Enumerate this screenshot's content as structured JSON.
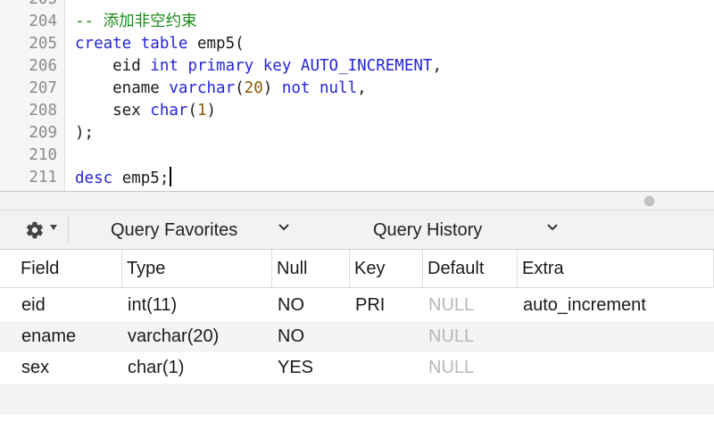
{
  "editor": {
    "lines": [
      {
        "num": "203",
        "tokens": []
      },
      {
        "num": "204",
        "tokens": [
          {
            "t": "-- 添加非空约束",
            "c": "cm"
          }
        ]
      },
      {
        "num": "205",
        "tokens": [
          {
            "t": "create",
            "c": "kw"
          },
          {
            "t": " ",
            "c": ""
          },
          {
            "t": "table",
            "c": "kw"
          },
          {
            "t": " emp5(",
            "c": ""
          }
        ]
      },
      {
        "num": "206",
        "tokens": [
          {
            "t": "    eid ",
            "c": ""
          },
          {
            "t": "int",
            "c": "kw"
          },
          {
            "t": " ",
            "c": ""
          },
          {
            "t": "primary",
            "c": "kw"
          },
          {
            "t": " ",
            "c": ""
          },
          {
            "t": "key",
            "c": "kw"
          },
          {
            "t": " ",
            "c": ""
          },
          {
            "t": "AUTO_INCREMENT",
            "c": "kw"
          },
          {
            "t": ",",
            "c": ""
          }
        ]
      },
      {
        "num": "207",
        "tokens": [
          {
            "t": "    ename ",
            "c": ""
          },
          {
            "t": "varchar",
            "c": "kw"
          },
          {
            "t": "(",
            "c": ""
          },
          {
            "t": "20",
            "c": "num"
          },
          {
            "t": ") ",
            "c": ""
          },
          {
            "t": "not",
            "c": "kw"
          },
          {
            "t": " ",
            "c": ""
          },
          {
            "t": "null",
            "c": "kw"
          },
          {
            "t": ",",
            "c": ""
          }
        ]
      },
      {
        "num": "208",
        "tokens": [
          {
            "t": "    sex ",
            "c": ""
          },
          {
            "t": "char",
            "c": "kw"
          },
          {
            "t": "(",
            "c": ""
          },
          {
            "t": "1",
            "c": "num"
          },
          {
            "t": ")",
            "c": ""
          }
        ]
      },
      {
        "num": "209",
        "tokens": [
          {
            "t": ");",
            "c": ""
          }
        ]
      },
      {
        "num": "210",
        "tokens": []
      },
      {
        "num": "211",
        "tokens": [
          {
            "t": "desc",
            "c": "kw"
          },
          {
            "t": " emp5;",
            "c": ""
          }
        ],
        "caret": true
      }
    ]
  },
  "toolbar": {
    "gear_icon": "gear-icon",
    "favorites_label": "Query Favorites",
    "history_label": "Query History"
  },
  "results": {
    "columns": [
      "Field",
      "Type",
      "Null",
      "Key",
      "Default",
      "Extra"
    ],
    "rows": [
      [
        "eid",
        "int(11)",
        "NO",
        "PRI",
        "NULL",
        "auto_increment"
      ],
      [
        "ename",
        "varchar(20)",
        "NO",
        "",
        "NULL",
        ""
      ],
      [
        "sex",
        "char(1)",
        "YES",
        "",
        "NULL",
        ""
      ]
    ]
  }
}
